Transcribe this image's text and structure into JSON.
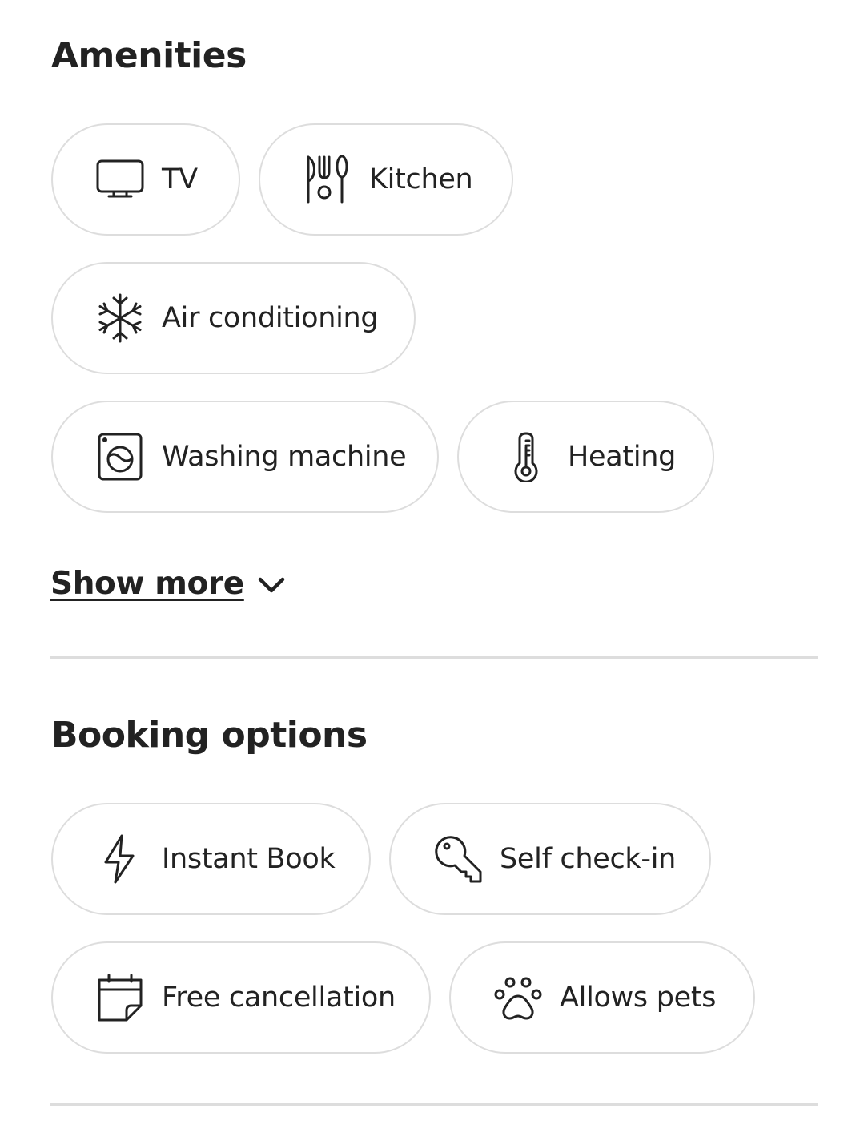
{
  "amenities": {
    "title": "Amenities",
    "items": [
      {
        "label": "TV",
        "icon": "tv-icon"
      },
      {
        "label": "Kitchen",
        "icon": "kitchen-utensils-icon"
      },
      {
        "label": "Air conditioning",
        "icon": "snowflake-icon"
      },
      {
        "label": "Washing machine",
        "icon": "washing-machine-icon"
      },
      {
        "label": "Heating",
        "icon": "thermometer-icon"
      }
    ],
    "show_more_label": "Show more",
    "show_more_icon": "chevron-down-icon"
  },
  "booking_options": {
    "title": "Booking options",
    "items": [
      {
        "label": "Instant Book",
        "icon": "lightning-bolt-icon"
      },
      {
        "label": "Self check-in",
        "icon": "key-icon"
      },
      {
        "label": "Free cancellation",
        "icon": "calendar-icon"
      },
      {
        "label": "Allows pets",
        "icon": "paw-icon"
      }
    ]
  },
  "colors": {
    "text": "#222222",
    "border": "#dddddd",
    "background": "#ffffff"
  }
}
